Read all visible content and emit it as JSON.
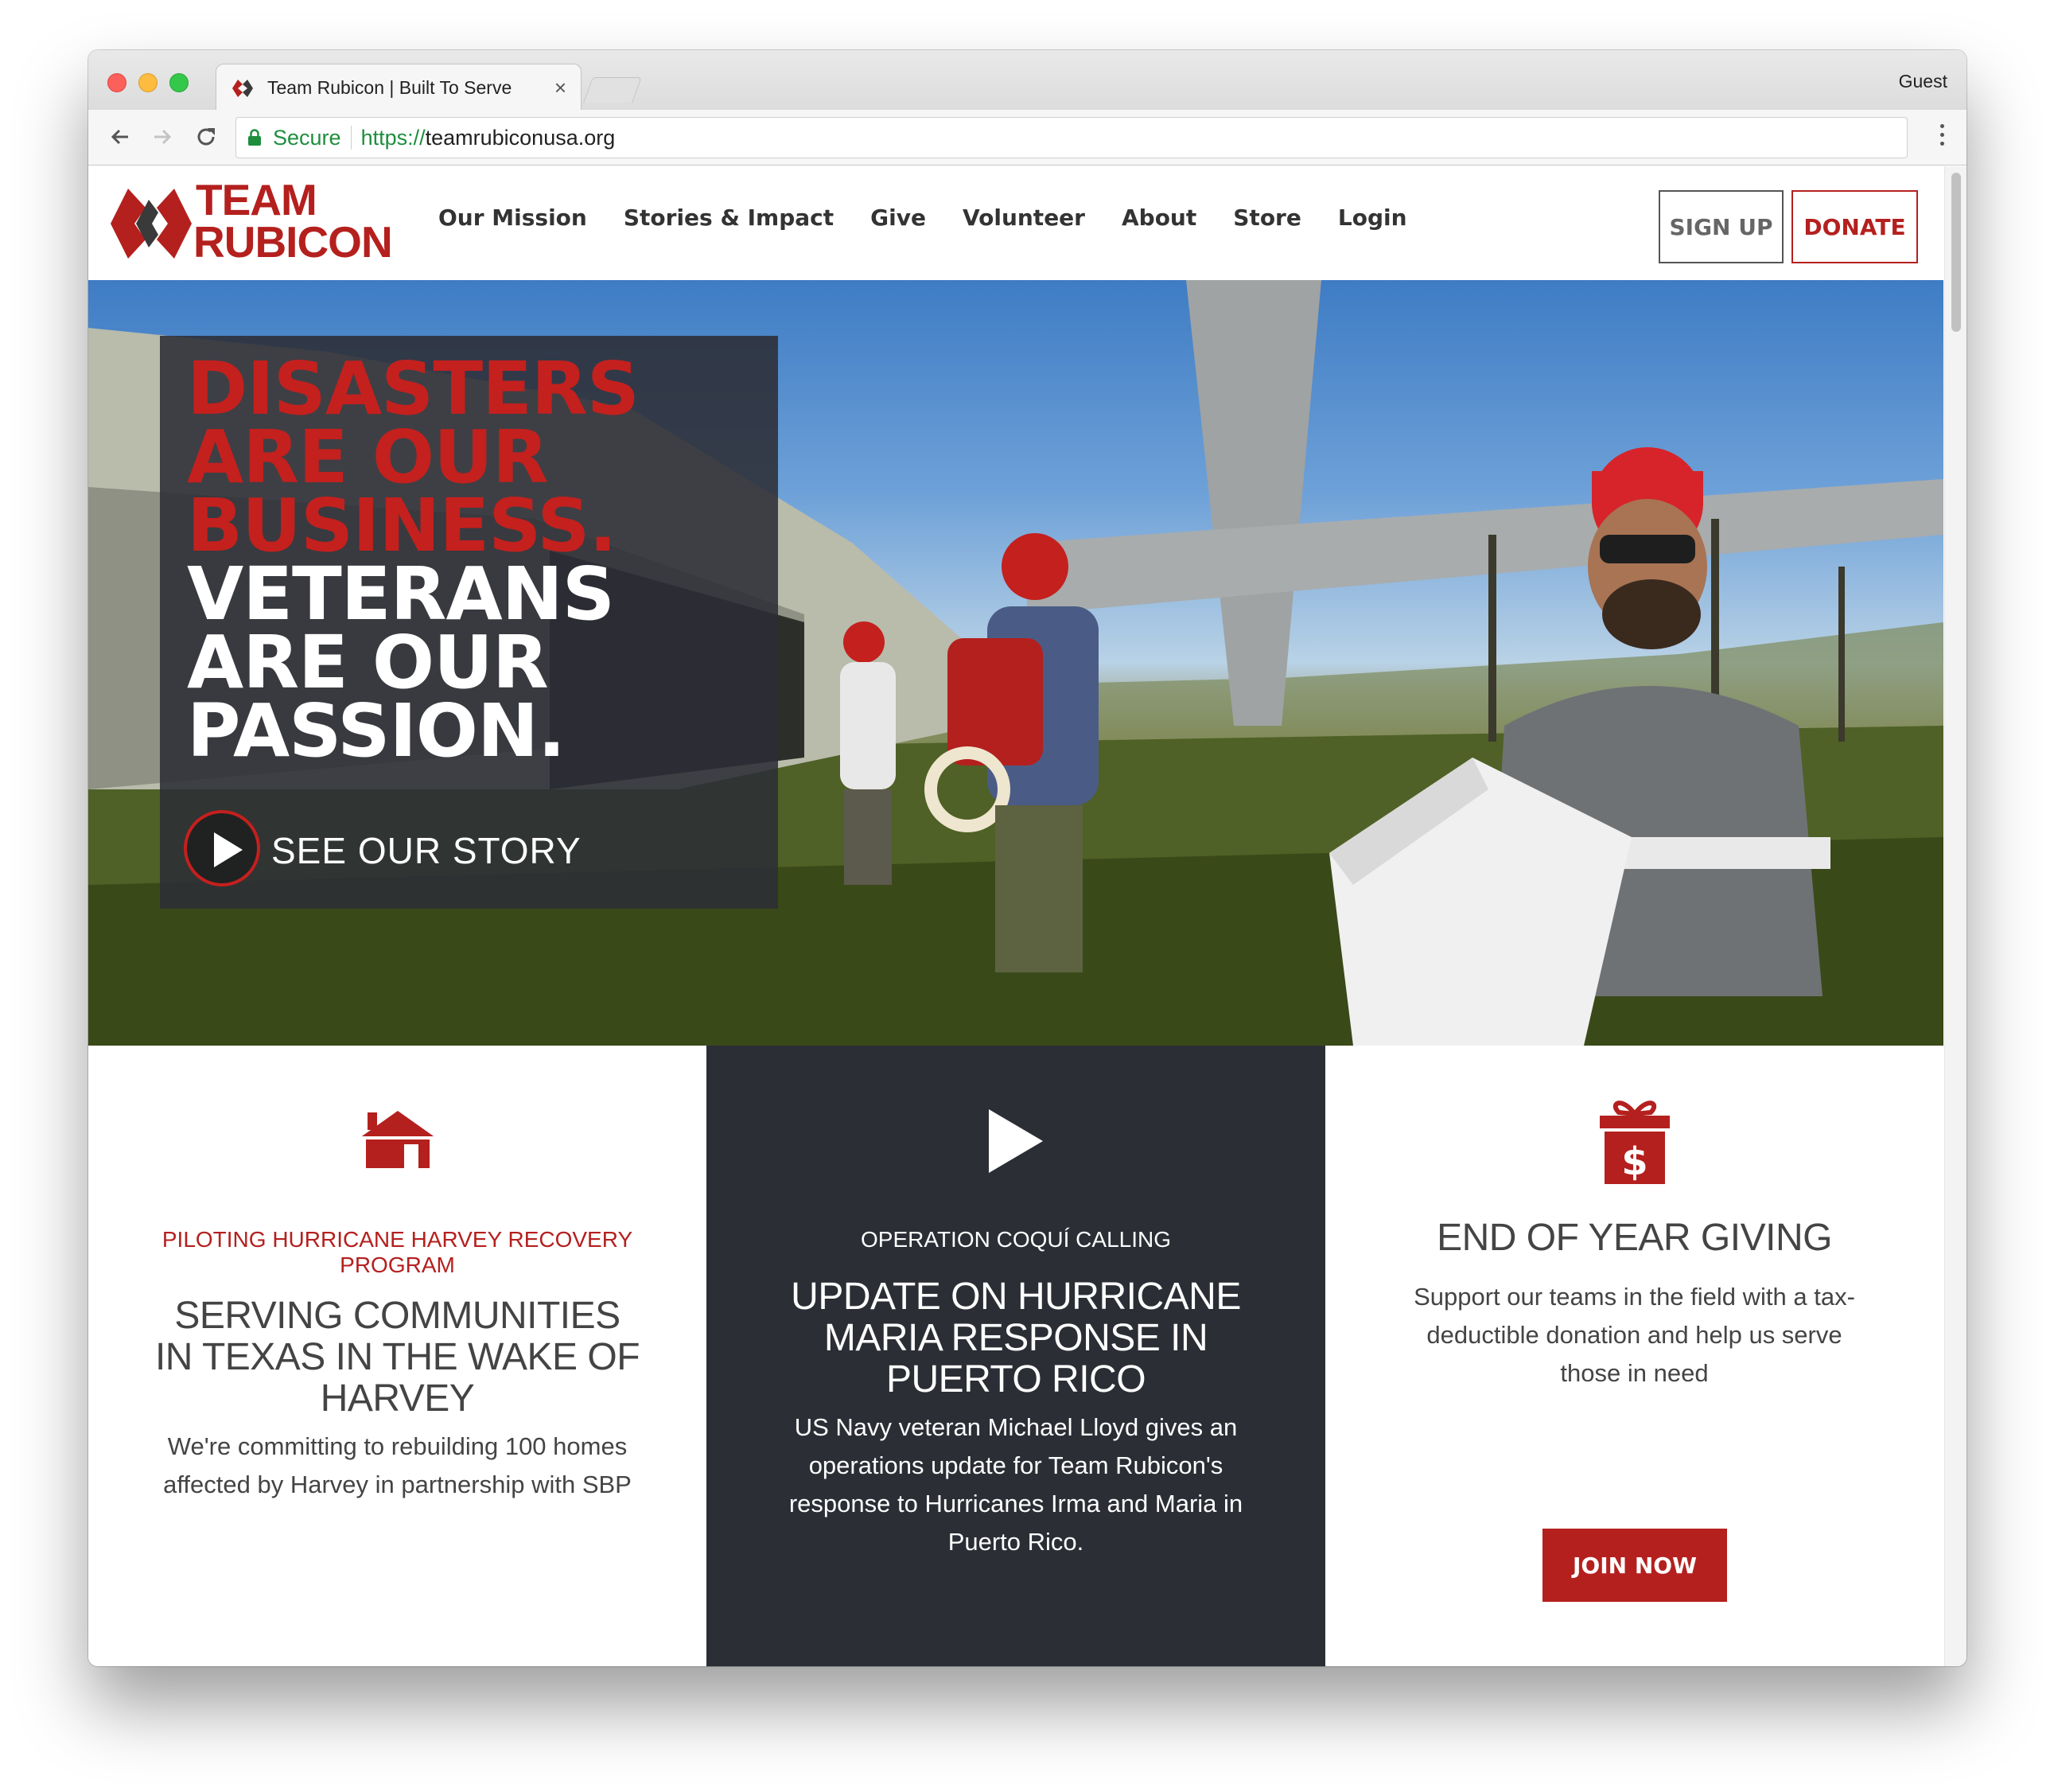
{
  "browser": {
    "tab_title": "Team Rubicon | Built To Serve",
    "tab_close": "×",
    "profile": "Guest",
    "secure_label": "Secure",
    "url_scheme": "https://",
    "url_host": "teamrubiconusa.org"
  },
  "site": {
    "logo_line1": "TEAM",
    "logo_line2": "RUBICON",
    "nav": [
      "Our Mission",
      "Stories & Impact",
      "Give",
      "Volunteer",
      "About",
      "Store",
      "Login"
    ],
    "signup_label": "SIGN UP",
    "donate_label": "DONATE"
  },
  "hero": {
    "red_lines": [
      "DISASTERS",
      "ARE OUR",
      "BUSINESS."
    ],
    "white_lines": [
      "VETERANS",
      "ARE OUR",
      "PASSION."
    ],
    "cta_label": "SEE OUR STORY"
  },
  "cards": [
    {
      "icon": "house-icon",
      "eyebrow": "PILOTING HURRICANE HARVEY RECOVERY PROGRAM",
      "title": "SERVING COMMUNITIES IN TEXAS IN THE WAKE OF HARVEY",
      "body": "We're committing to rebuilding 100 homes affected by Harvey in partnership with SBP"
    },
    {
      "icon": "play-icon",
      "eyebrow": "OPERATION COQUÍ CALLING",
      "title": "UPDATE ON HURRICANE MARIA RESPONSE IN PUERTO RICO",
      "body": "US Navy veteran Michael Lloyd gives an operations update for Team Rubicon's response to Hurricanes Irma and Maria in Puerto Rico."
    },
    {
      "icon": "gift-dollar-icon",
      "title": "END OF YEAR GIVING",
      "body": "Support our teams in the field with a tax-deductible donation and help us serve those in need",
      "button_label": "JOIN NOW"
    }
  ],
  "colors": {
    "brand_red": "#b4201e",
    "dark_panel": "#2b2e35",
    "text_gray": "#444444"
  }
}
